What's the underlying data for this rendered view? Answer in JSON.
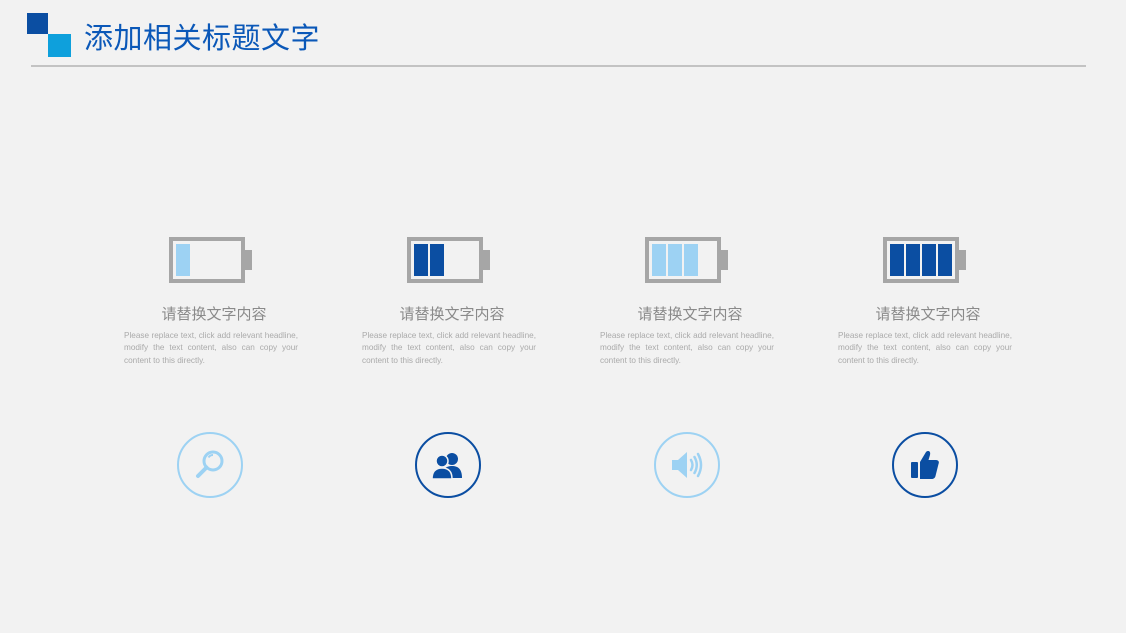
{
  "header": {
    "title": "添加相关标题文字"
  },
  "colors": {
    "dark_blue": "#0b4ea2",
    "light_blue": "#9dd2f3",
    "battery_gray": "#a6a6a6",
    "title_blue": "#0b58b8"
  },
  "cards": [
    {
      "battery_level": "1 of 4 cells (light)",
      "title": "请替换文字内容",
      "body": "Please replace text, click add relevant headline, modify the text content, also can copy your content to this directly."
    },
    {
      "battery_level": "2 of 4 cells (dark)",
      "title": "请替换文字内容",
      "body": "Please replace text, click add relevant headline, modify the text content, also can copy your content to this directly."
    },
    {
      "battery_level": "3 of 4 cells (light)",
      "title": "请替换文字内容",
      "body": "Please replace text, click add relevant headline, modify the text content, also can copy your content to this directly."
    },
    {
      "battery_level": "4 of 4 cells (dark)",
      "title": "请替换文字内容",
      "body": "Please replace text, click add relevant headline, modify the text content, also can copy your content to this directly."
    }
  ],
  "icons": [
    {
      "name": "magnifier-icon",
      "style": "light"
    },
    {
      "name": "users-icon",
      "style": "dark"
    },
    {
      "name": "speaker-icon",
      "style": "light"
    },
    {
      "name": "thumbs-up-icon",
      "style": "dark"
    }
  ]
}
